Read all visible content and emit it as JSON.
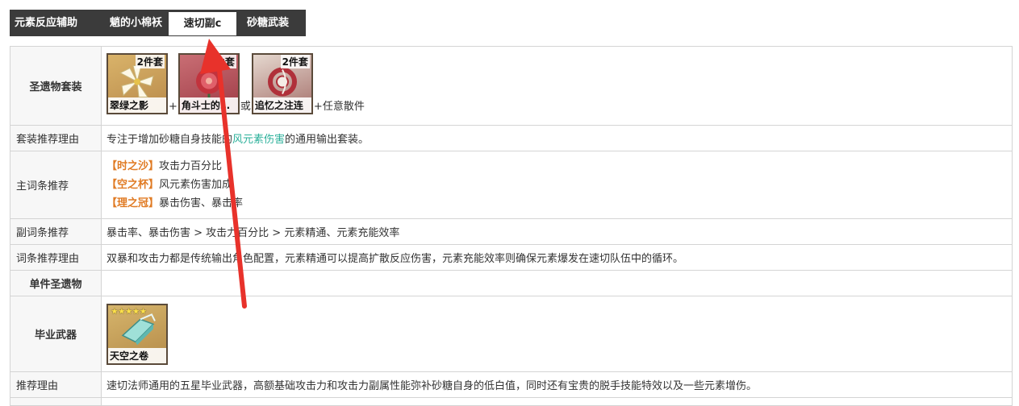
{
  "tabs": [
    {
      "label": "元素反应辅助",
      "active": false
    },
    {
      "label": "魈的小棉袄",
      "active": false
    },
    {
      "label": "速切副c",
      "active": true
    },
    {
      "label": "砂糖武装",
      "active": false
    }
  ],
  "rows": {
    "artifact_set": {
      "label": "圣遗物套装",
      "items": [
        {
          "badge": "2件套",
          "name": "翠绿之影",
          "icon": "lily-flower-icon"
        },
        {
          "badge": "2件套",
          "name": "角斗士的…",
          "icon": "red-flower-icon"
        },
        {
          "badge": "2件套",
          "name": "追忆之注连",
          "icon": "shimenawa-icon"
        }
      ],
      "plus1": "+",
      "or": "或",
      "suffix": "+任意散件"
    },
    "set_reason": {
      "label": "套装推荐理由",
      "before": "专注于增加砂糖自身技能的",
      "highlight": "风元素伤害",
      "after": "的通用输出套装。"
    },
    "main_stats": {
      "label": "主词条推荐",
      "lines": [
        {
          "slot": "【时之沙】",
          "stat": "攻击力百分比"
        },
        {
          "slot": "【空之杯】",
          "stat": "风元素伤害加成"
        },
        {
          "slot": "【理之冠】",
          "stat": "暴击伤害、暴击率"
        }
      ]
    },
    "sub_stats": {
      "label": "副词条推荐",
      "value": "暴击率、暴击伤害 > 攻击力百分比 > 元素精通、元素充能效率"
    },
    "stat_reason": {
      "label": "词条推荐理由",
      "value": "双暴和攻击力都是传统输出角色配置，元素精通可以提高扩散反应伤害，元素充能效率则确保元素爆发在速切队伍中的循环。"
    },
    "single_artifact": {
      "label": "单件圣遗物",
      "value": ""
    },
    "best_weapon": {
      "label": "毕业武器",
      "item": {
        "stars": "★★★★★",
        "name": "天空之卷",
        "icon": "sky-book-icon"
      }
    },
    "weapon_reason": {
      "label": "推荐理由",
      "value": "速切法师通用的五星毕业武器，高额基础攻击力和攻击力副属性能弥补砂糖自身的低白值，同时还有宝贵的脱手技能特效以及一些元素增伤。"
    }
  },
  "colors": {
    "accent_green": "#2bb09a",
    "accent_orange": "#e07b24",
    "tab_bar": "#3b3b3b",
    "annotation_arrow": "#e8322b"
  }
}
